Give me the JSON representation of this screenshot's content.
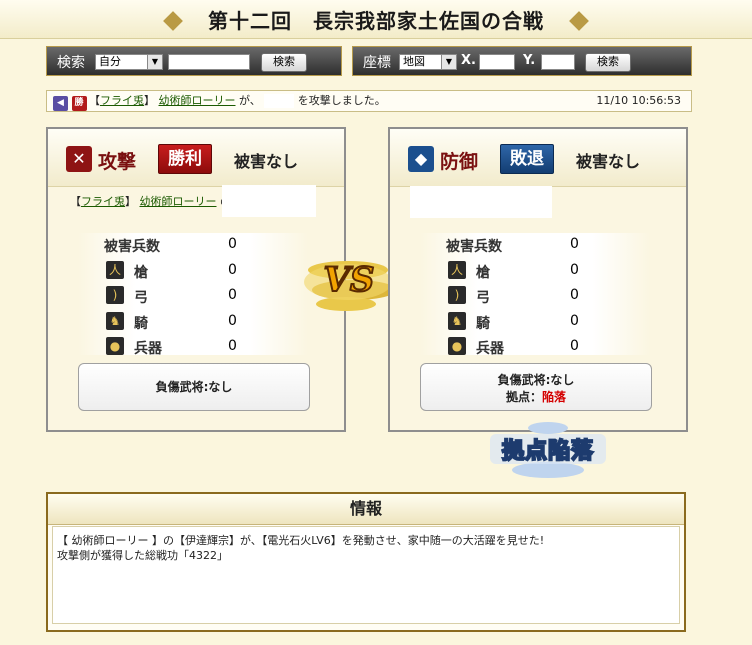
{
  "title": "第十二回　長宗我部家土佐国の合戦",
  "search": {
    "label": "検索",
    "select_value": "自分",
    "button": "検索"
  },
  "coords": {
    "label": "座標",
    "select_value": "地図",
    "x_label": "X.",
    "y_label": "Y.",
    "button": "検索"
  },
  "log": {
    "badge": "勝",
    "attacker_tag": "フライ兎",
    "attacker_name": "幼術師ローリー",
    "text_ga": "が、",
    "text_action": "を攻撃しました。",
    "timestamp": "11/10 10:56:53"
  },
  "attack_panel": {
    "side": "攻撃",
    "result": "勝利",
    "damage_status": "被害なし",
    "owner_tag": "フライ兎",
    "owner_name": "幼術師ローリー",
    "owner_suffix": "の",
    "stats_label": "被害兵数",
    "stats_total": "0",
    "units": [
      {
        "name": "槍",
        "value": "0"
      },
      {
        "name": "弓",
        "value": "0"
      },
      {
        "name": "騎",
        "value": "0"
      },
      {
        "name": "兵器",
        "value": "0"
      }
    ],
    "injured_label": "負傷武将:なし"
  },
  "defense_panel": {
    "side": "防御",
    "result": "敗退",
    "damage_status": "被害なし",
    "stats_label": "被害兵数",
    "stats_total": "0",
    "units": [
      {
        "name": "槍",
        "value": "0"
      },
      {
        "name": "弓",
        "value": "0"
      },
      {
        "name": "騎",
        "value": "0"
      },
      {
        "name": "兵器",
        "value": "0"
      }
    ],
    "injured_label": "負傷武将:なし",
    "base_label": "拠点：",
    "base_status": "陥落"
  },
  "vs_label": "VS",
  "stamp_label": "拠点陥落",
  "info": {
    "header": "情報",
    "line1": "【 幼術師ローリー 】の【伊達輝宗】が、【電光石火LV6】を発動させ、家中随一の大活躍を見せた!",
    "line2": "攻撃側が獲得した総戦功「4322」"
  }
}
